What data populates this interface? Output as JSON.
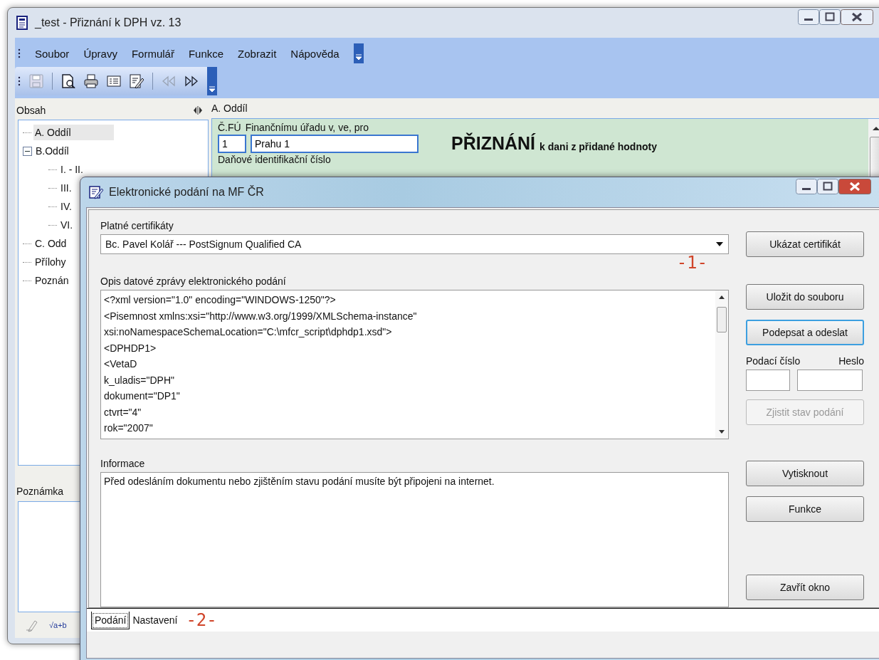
{
  "main_window": {
    "title": "_test - Přiznání k DPH vz. 13",
    "menu": [
      "Soubor",
      "Úpravy",
      "Formulář",
      "Funkce",
      "Zobrazit",
      "Nápověda"
    ],
    "toolbar": [
      {
        "kind": "save",
        "disabled": true
      },
      {
        "kind": "preview",
        "disabled": false
      },
      {
        "kind": "print",
        "disabled": false
      },
      {
        "kind": "form",
        "disabled": false
      },
      {
        "kind": "edit",
        "disabled": false
      },
      {
        "kind": "previous",
        "disabled": true
      },
      {
        "kind": "next",
        "disabled": false
      }
    ],
    "contents": {
      "title": "Obsah",
      "tree": [
        {
          "label": "A. Oddíl",
          "selected": true
        },
        {
          "label": "B.Oddíl",
          "selected": false,
          "expanded": true,
          "children": [
            {
              "label": "I. - II.",
              "selected": false
            },
            {
              "label": "III.",
              "selected": false
            },
            {
              "label": "IV.",
              "selected": false
            },
            {
              "label": "VI.",
              "selected": false
            }
          ]
        },
        {
          "label": "C. Odd",
          "selected": false
        },
        {
          "label": "Přílohy",
          "selected": false
        },
        {
          "label": "Poznán",
          "selected": false
        }
      ]
    },
    "note": {
      "title": "Poznámka",
      "tools": [
        {
          "kind": "pencil"
        },
        {
          "kind": "formula",
          "label": "√a+b"
        }
      ]
    },
    "form": {
      "section": "A. Oddíl",
      "fu_label": "Č.FÚ",
      "fu_value": "1",
      "office_label": "Finančnímu úřadu v, ve, pro",
      "office_value": "Prahu 1",
      "heading": "PŘIZNÁNÍ",
      "subheading": "k dani z přidané hodnoty",
      "dic_label": "Daňové identifikační číslo"
    }
  },
  "dialog": {
    "title": "Elektronické podání na MF ČR",
    "certificates_label": "Platné certifikáty",
    "certificate": "Bc. Pavel Kolář --- PostSignum Qualified CA",
    "message_label": "Opis datové zprávy elektronického podání",
    "message_lines": [
      "<?xml version=\"1.0\" encoding=\"WINDOWS-1250\"?>",
      "<Pisemnost xmlns:xsi=\"http://www.w3.org/1999/XMLSchema-instance\"",
      "xsi:noNamespaceSchemaLocation=\"C:\\mfcr_script\\dphdp1.xsd\">",
      "<DPHDP1>",
      "<VetaD",
      "k_uladis=\"DPH\"",
      "dokument=\"DP1\"",
      "ctvrt=\"4\"",
      "rok=\"2007\""
    ],
    "info_label": "Informace",
    "info_text": "Před odesláním dokumentu nebo zjištěním stavu podání musíte být připojeni na internet.",
    "certificate_button": "Ukázat certifikát",
    "file_buttons": [
      {
        "label": "Uložit do souboru",
        "focused": false
      },
      {
        "label": "Podepsat a odeslat",
        "focused": true
      }
    ],
    "filing_number_label": "Podací číslo",
    "password_label": "Heslo",
    "status_button": {
      "label": "Zjistit stav podání",
      "disabled": true
    },
    "print_buttons": [
      {
        "label": "Vytisknout"
      },
      {
        "label": "Funkce"
      }
    ],
    "close_button": "Zavřít okno",
    "tabs": [
      {
        "label": "Podání",
        "selected": true
      },
      {
        "label": "Nastavení",
        "selected": false
      }
    ]
  },
  "annotations": [
    "-1-",
    "-2-"
  ]
}
